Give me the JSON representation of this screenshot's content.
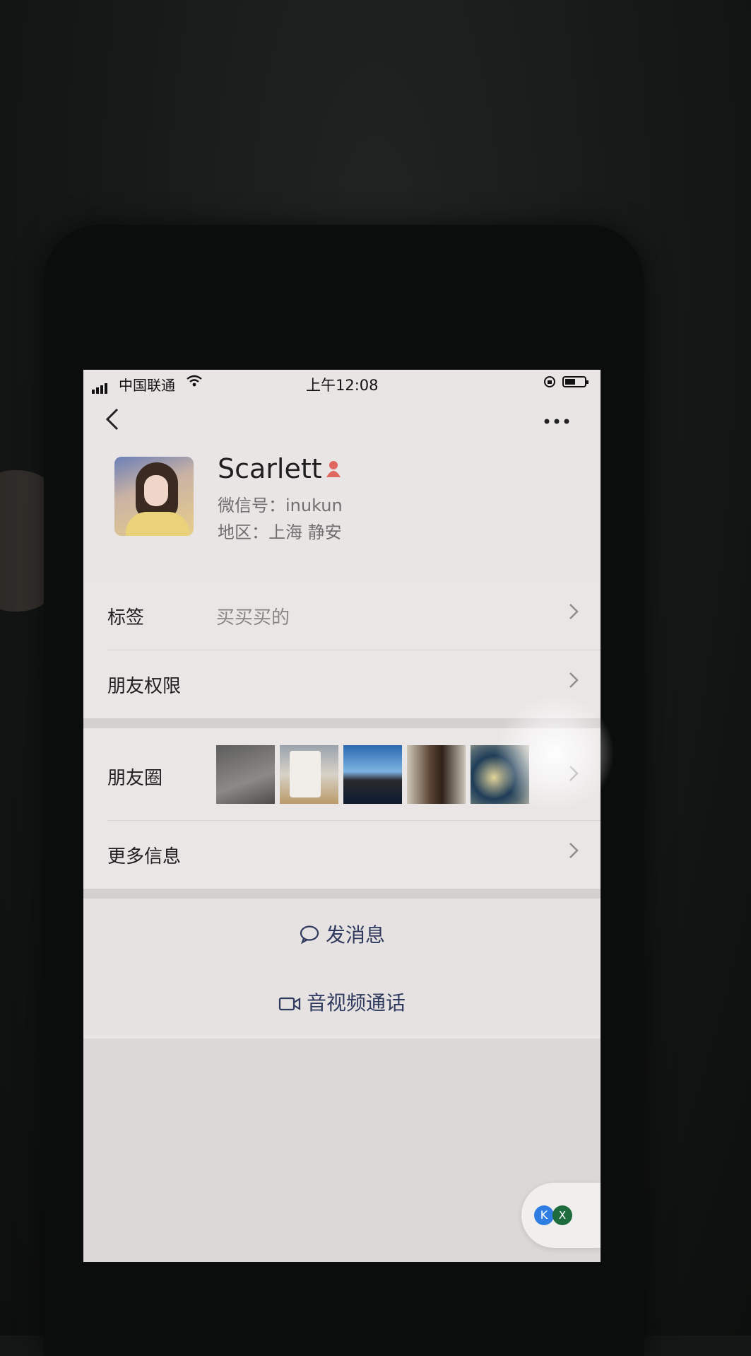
{
  "status_bar": {
    "carrier": "中国联通",
    "time": "上午12:08"
  },
  "profile": {
    "name": "Scarlett",
    "wechat_id": "微信号：inukun",
    "region": "地区：上海 静安"
  },
  "rows": {
    "tags_label": "标签",
    "tags_value": "买买买的",
    "permissions_label": "朋友权限",
    "moments_label": "朋友圈",
    "more_info_label": "更多信息"
  },
  "actions": {
    "send_message": "发消息",
    "video_call": "音视频通话"
  },
  "floating": {
    "k_label": "K",
    "x_label": "X"
  },
  "colors": {
    "gender_icon": "#e0675f",
    "action_text": "#2f3a5e"
  }
}
